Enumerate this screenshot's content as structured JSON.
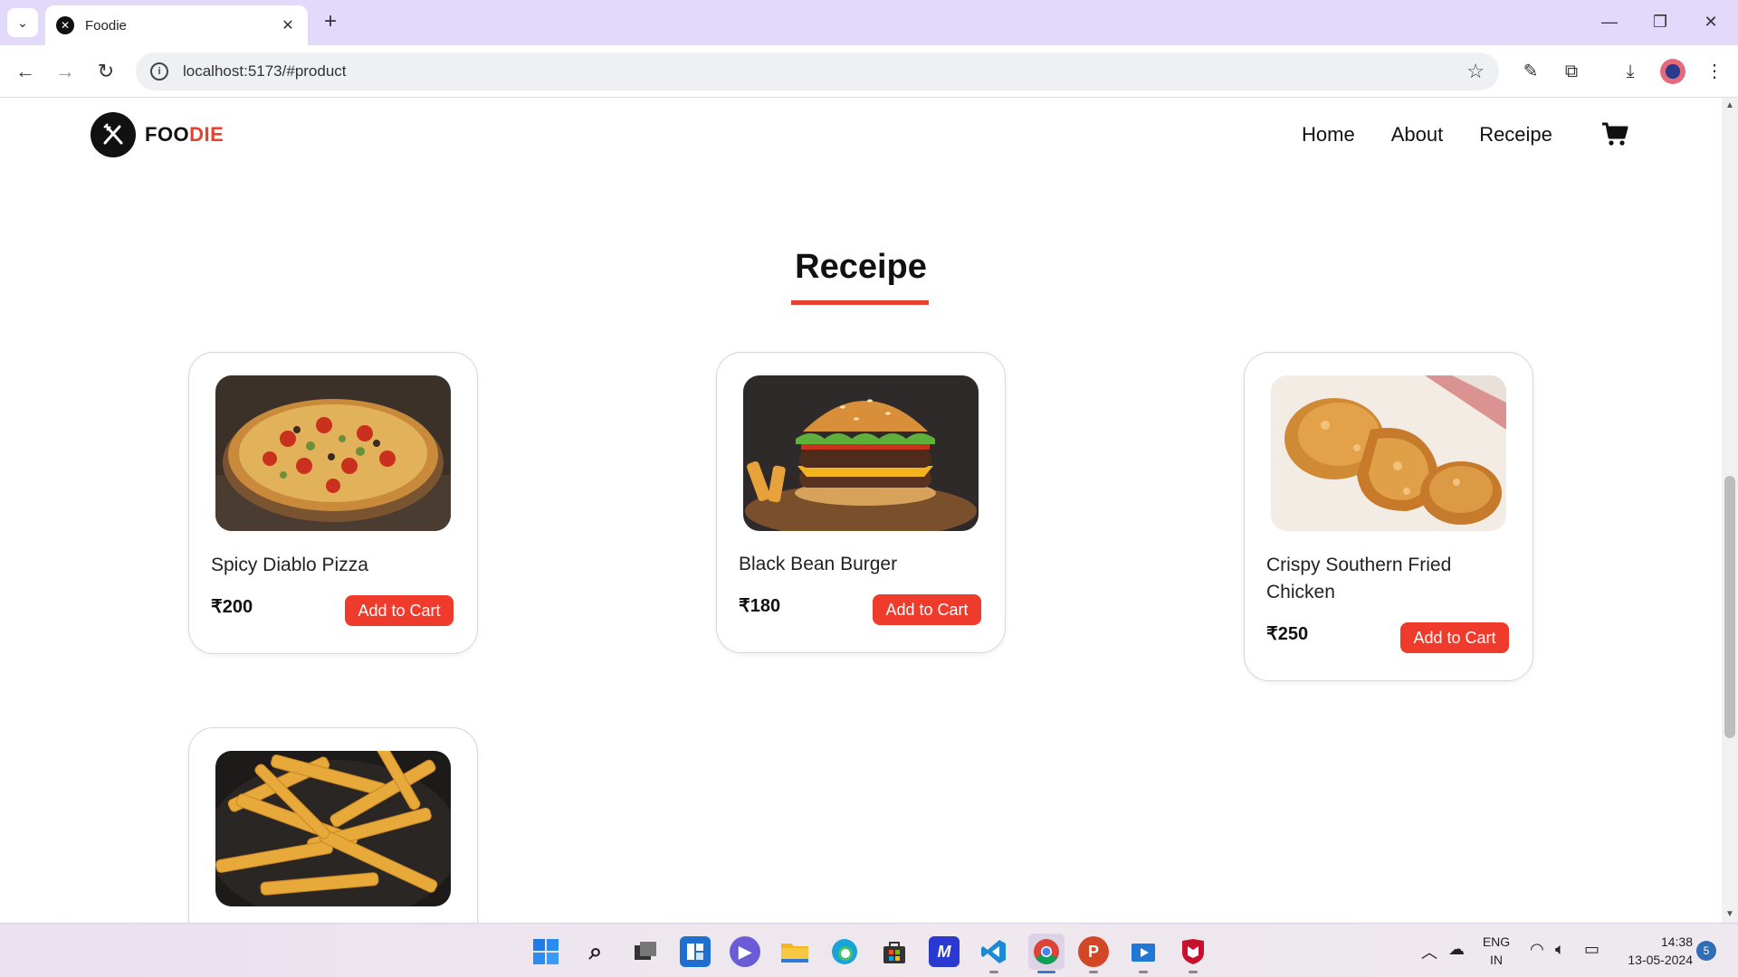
{
  "browser": {
    "tab_title": "Foodie",
    "url": "localhost:5173/#product"
  },
  "site": {
    "logo_part1": "FOO",
    "logo_part2": "DIE",
    "nav": [
      "Home",
      "About",
      "Receipe"
    ],
    "accent_color": "#e8412c"
  },
  "section": {
    "title": "Receipe"
  },
  "products": [
    {
      "name": "Spicy Diablo Pizza",
      "price": "₹200",
      "button": "Add to Cart",
      "image": "pizza"
    },
    {
      "name": "Black Bean Burger",
      "price": "₹180",
      "button": "Add to Cart",
      "image": "burger"
    },
    {
      "name": "Crispy Southern Fried Chicken",
      "price": "₹250",
      "button": "Add to Cart",
      "image": "fried-chicken"
    },
    {
      "name": "",
      "price": "",
      "button": "",
      "image": "fries"
    }
  ],
  "taskbar": {
    "lang1": "ENG",
    "lang2": "IN",
    "time": "14:38",
    "date": "13-05-2024",
    "notifications": "5"
  }
}
